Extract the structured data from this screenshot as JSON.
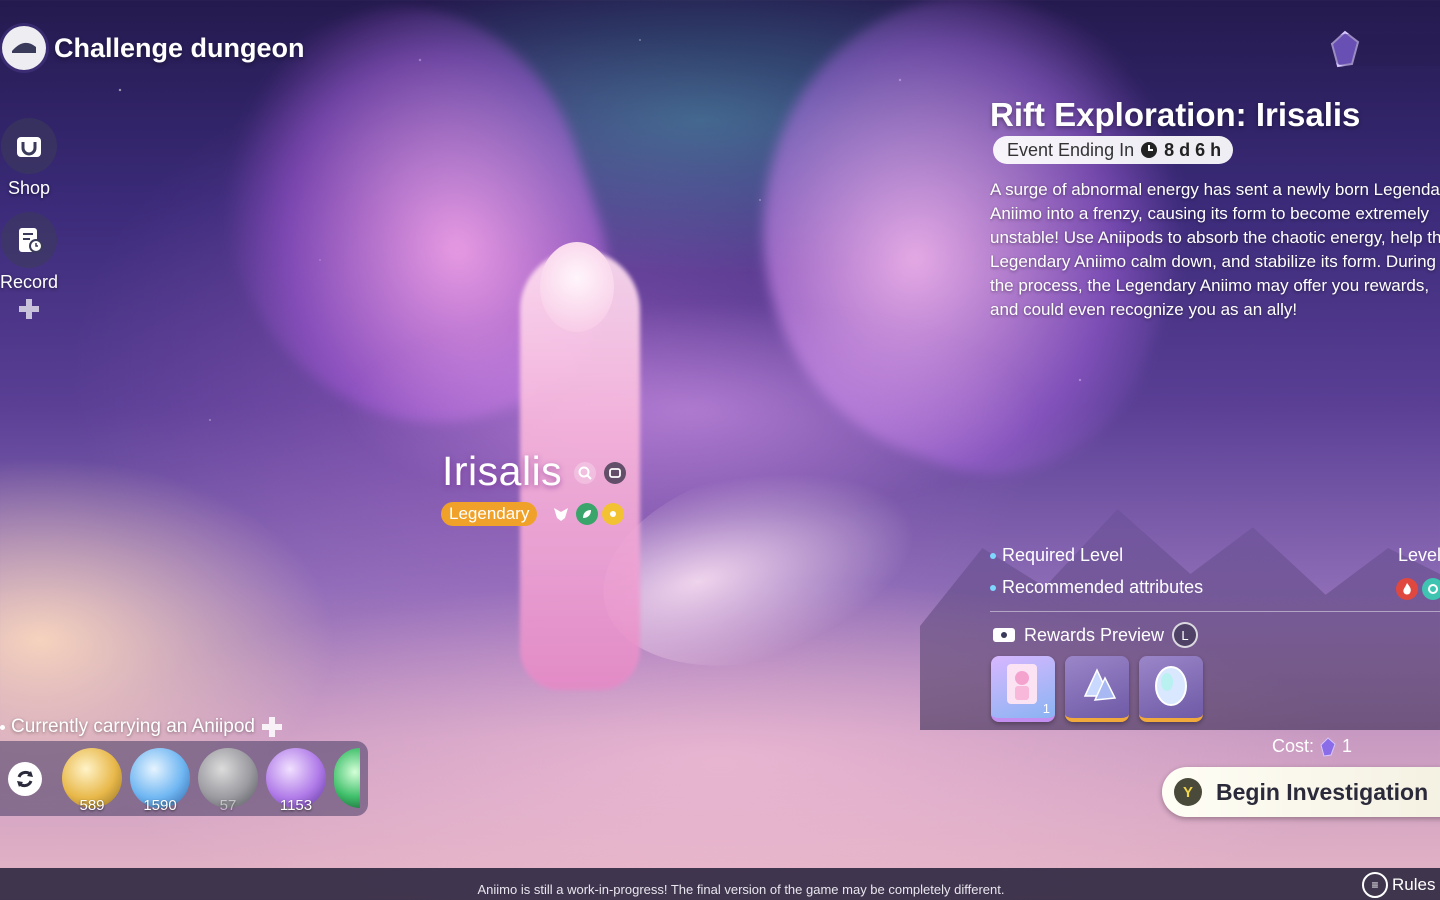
{
  "header": {
    "title": "Challenge dungeon"
  },
  "sidebar": {
    "items": [
      {
        "label": "Shop",
        "icon": "shop-bag-icon"
      },
      {
        "label": "Record",
        "icon": "record-clock-icon"
      }
    ]
  },
  "event": {
    "title": "Rift Exploration: Irisalis",
    "timer_label": "Event Ending In",
    "timer_value": "8 d 6 h",
    "description": "A surge of abnormal energy has sent a newly born Legendary Aniimo into a frenzy, causing its form to become extremely unstable! Use Aniipods to absorb the chaotic energy, help the Legendary Aniimo calm down, and stabilize its form. During the process, the Legendary Aniimo may offer you rewards, and could even recognize you as an ally!",
    "required_level_label": "Required Level",
    "required_level_value": "Level",
    "recommended_attributes_label": "Recommended attributes",
    "recommended_attributes": [
      "fire",
      "wind"
    ],
    "rewards_label": "Rewards Preview",
    "rewards_key": "L",
    "rewards": [
      {
        "name": "character-card",
        "qty": "1"
      },
      {
        "name": "crystal-shards",
        "qty": ""
      },
      {
        "name": "aurora-egg",
        "qty": ""
      }
    ],
    "cost_label": "Cost:",
    "cost_value": "1",
    "begin_button_key": "Y",
    "begin_button_label": "Begin Investigation"
  },
  "character": {
    "name": "Irisalis",
    "rarity": "Legendary"
  },
  "carry": {
    "label": "Currently carrying an Aniipod",
    "pods": [
      {
        "name": "gold-pod",
        "count": "589",
        "color": "#e8b84a"
      },
      {
        "name": "blue-pod",
        "count": "1590",
        "color": "#6fb6f2"
      },
      {
        "name": "gray-pod",
        "count": "57",
        "color": "#9a9aa0"
      },
      {
        "name": "purple-pod",
        "count": "1153",
        "color": "#b07be8"
      }
    ]
  },
  "footer": {
    "notice": "Aniimo is still a work-in-progress! The final version of the game may be completely different.",
    "rules_label": "Rules"
  },
  "colors": {
    "accent": "#f0a12a",
    "button": "#fffef5"
  }
}
